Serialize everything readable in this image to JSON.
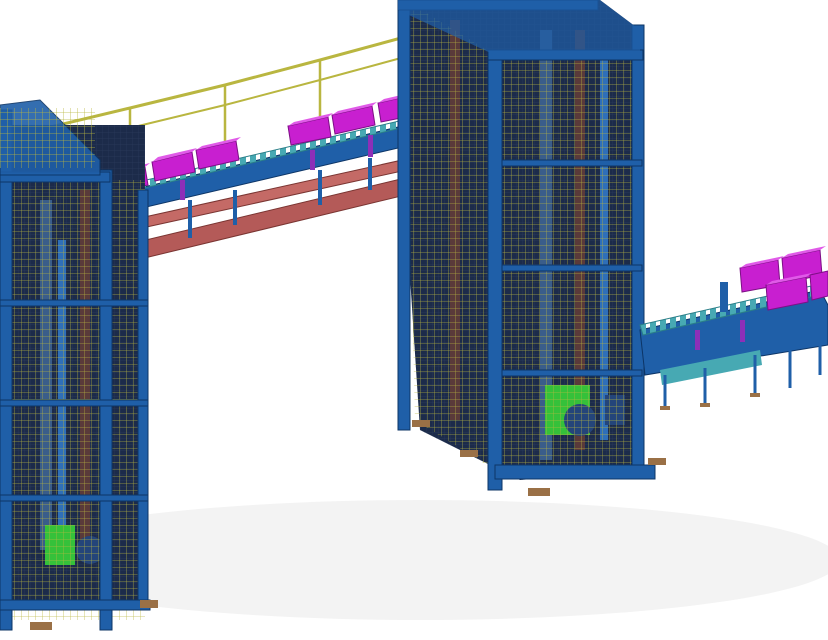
{
  "scene": {
    "subject": "cad-render-vertical-lift-conveyor-system",
    "colors": {
      "background": "#ffffff",
      "frame_blue": "#1f5fa8",
      "frame_dark": "#0d3566",
      "mesh_yellow": "#b9b640",
      "bridge_rust": "#b45a58",
      "roller_teal": "#47a9b3",
      "box_magenta": "#c81fd0",
      "box_magenta_light": "#e05ae8",
      "motor_green": "#35c13a",
      "foot_brown": "#9a7046",
      "interior_dark": "#1c2b4a"
    }
  }
}
